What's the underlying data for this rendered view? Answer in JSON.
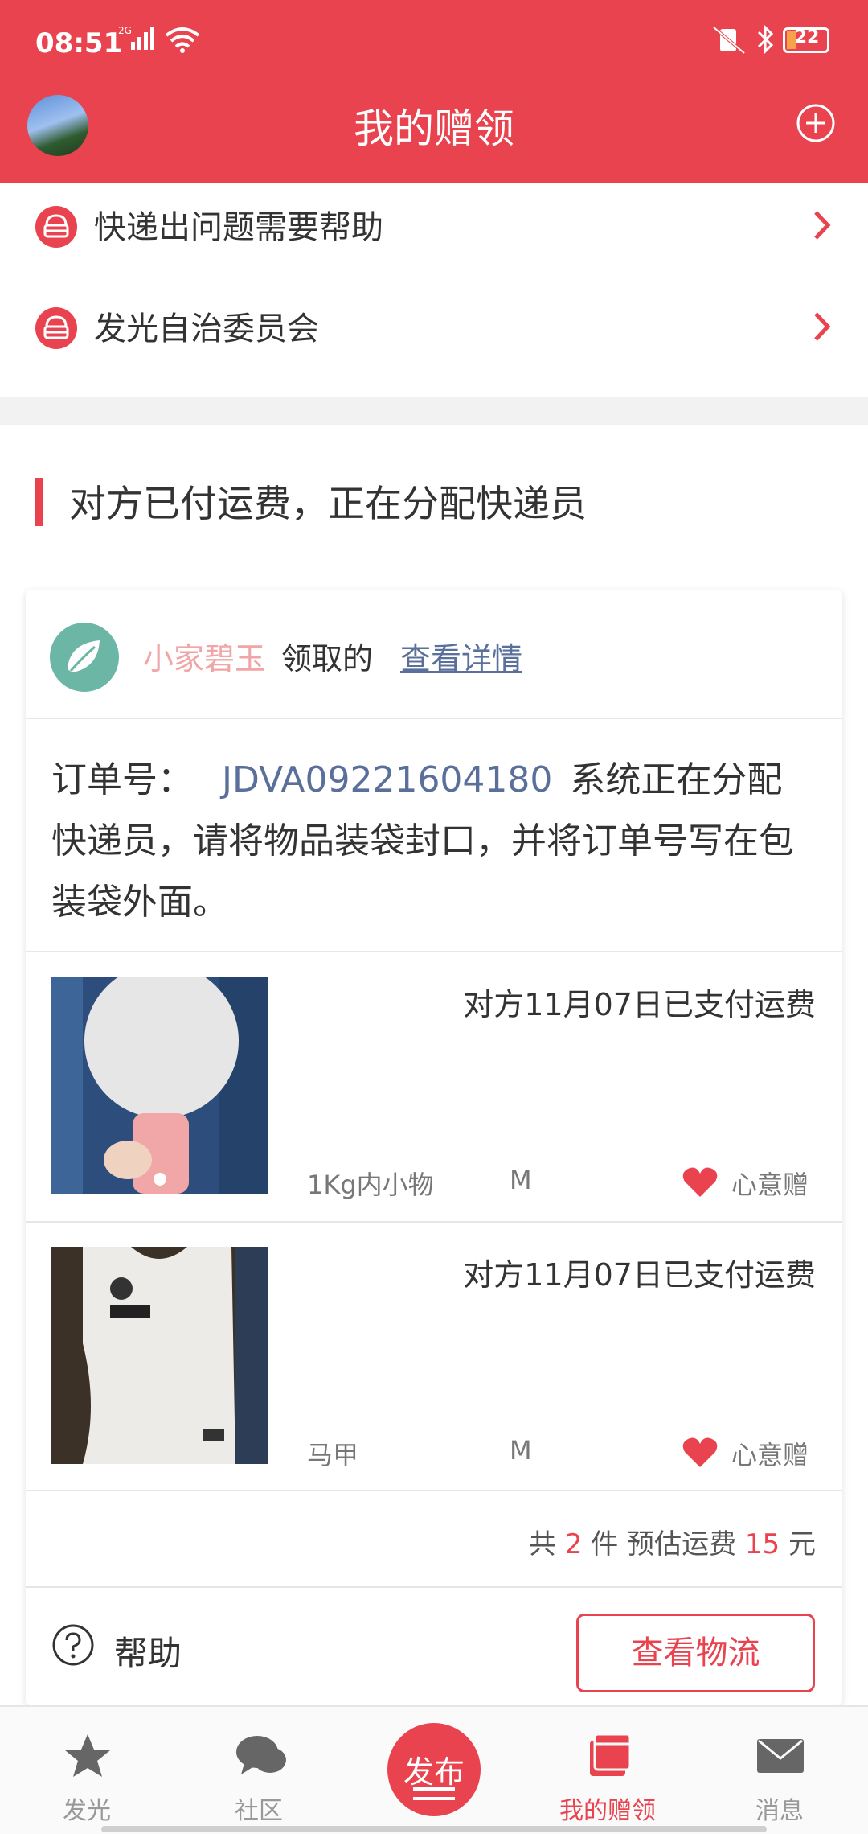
{
  "status_bar": {
    "time": "08:51",
    "network": "2G",
    "battery": "22"
  },
  "header": {
    "title": "我的赠领",
    "add_icon": "plus-circle-icon"
  },
  "help_links": [
    {
      "label": "快递出问题需要帮助",
      "icon": "support-icon"
    },
    {
      "label": "发光自治委员会",
      "icon": "support-icon"
    }
  ],
  "status_section": {
    "text": "对方已付运费，正在分配快递员"
  },
  "card": {
    "user_name": "小家碧玉",
    "received_label": "领取的",
    "detail_link": "查看详情",
    "order_prefix": "订单号：",
    "order_number": "JDVA09221604180",
    "order_message": "系统正在分配快递员，请将物品装袋封口，并将订单号写在包装袋外面。",
    "items": [
      {
        "paid_text": "对方11月07日已支付运费",
        "category": "1Kg内小物",
        "size": "M",
        "gift_label": "心意赠"
      },
      {
        "paid_text": "对方11月07日已支付运费",
        "category": "马甲",
        "size": "M",
        "gift_label": "心意赠"
      }
    ],
    "summary": {
      "prefix": "共",
      "count": "2",
      "unit": "件",
      "shipping_label": "预估运费",
      "shipping_value": "15",
      "currency": "元"
    },
    "help_label": "帮助",
    "logistics_button": "查看物流"
  },
  "bottom_nav": {
    "items": [
      {
        "label": "发光",
        "icon": "star-icon"
      },
      {
        "label": "社区",
        "icon": "chat-icon"
      },
      {
        "label": "发布",
        "icon": "publish-icon"
      },
      {
        "label": "我的赠领",
        "icon": "book-icon"
      },
      {
        "label": "消息",
        "icon": "mail-icon"
      }
    ]
  },
  "colors": {
    "brand_red": "#e8434f",
    "link_blue": "#5a6f9a",
    "teal": "#6cb6a6"
  }
}
